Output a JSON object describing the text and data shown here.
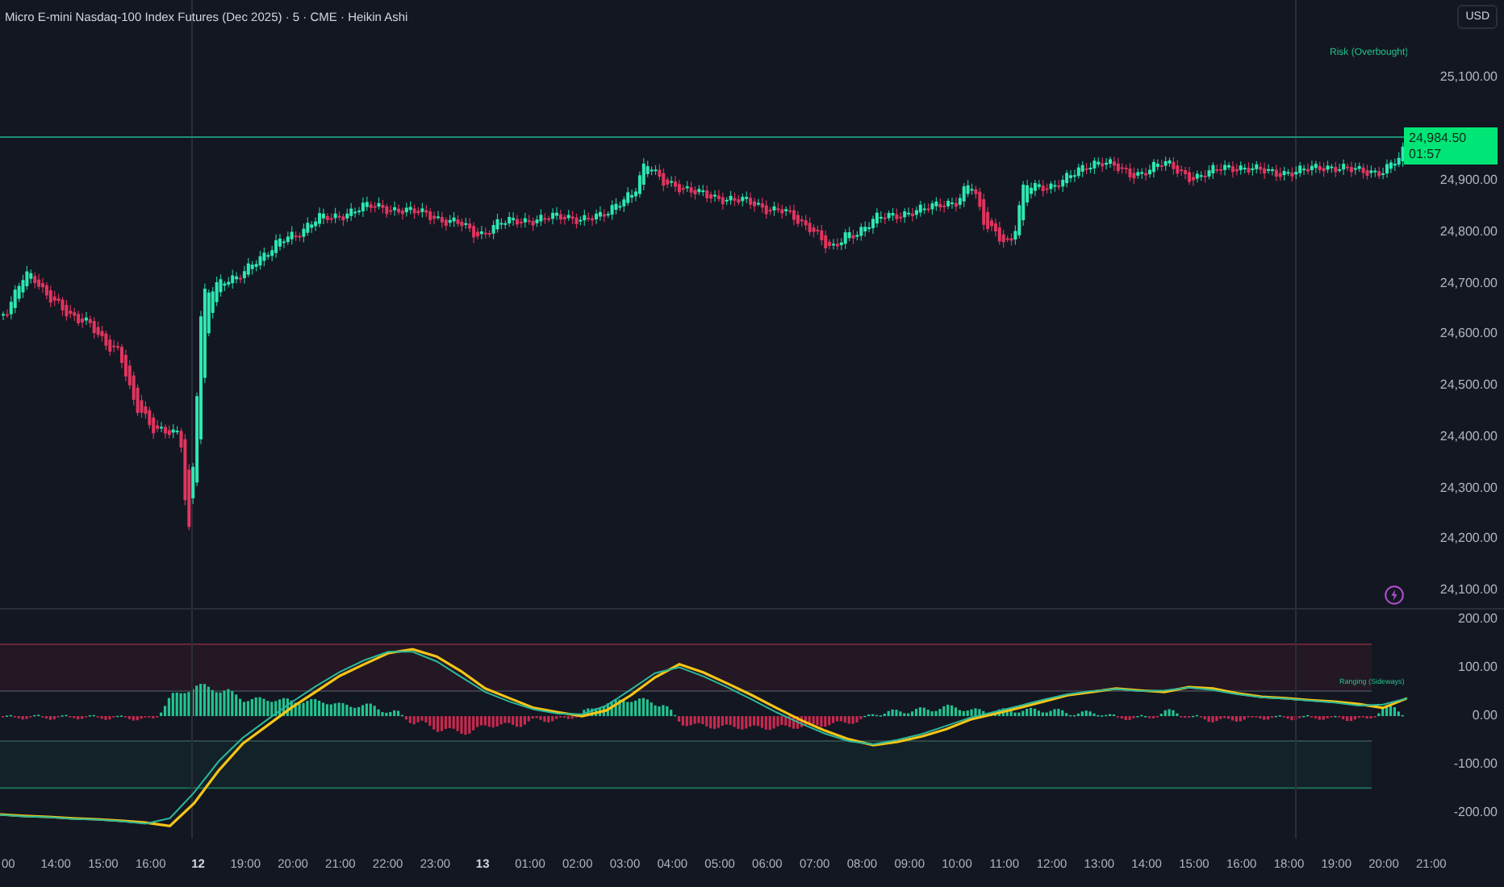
{
  "header": {
    "title": "Micro E-mini Nasdaq-100 Index Futures (Dec 2025) · 5 · CME · Heikin Ashi",
    "currency": "USD"
  },
  "main_pane": {
    "zone_label": "Risk (Overbought)"
  },
  "price_axis": {
    "upper": [
      "25,100.00"
    ],
    "lower": [
      "24,900.00",
      "24,800.00",
      "24,700.00",
      "24,600.00",
      "24,500.00",
      "24,400.00",
      "24,300.00",
      "24,200.00",
      "24,100.00"
    ]
  },
  "last_price": {
    "value": "24,984.50",
    "countdown": "01:57"
  },
  "indicator_pane": {
    "zone_label": "Ranging (Sideways)",
    "chart_data": {
      "type": "line",
      "ylim": [
        -253,
        220
      ],
      "yticks": [
        {
          "value": 200,
          "label": "200.00"
        },
        {
          "value": 100,
          "label": "100.00"
        },
        {
          "value": 0,
          "label": "0.00"
        },
        {
          "value": -100,
          "label": "-100.00"
        },
        {
          "value": -200,
          "label": "-200.00"
        }
      ],
      "series": [
        {
          "color": "#f5c518",
          "values": [
            -203,
            -206,
            -208,
            -211,
            -213,
            -216,
            -220,
            -227,
            -180,
            -113,
            -57,
            -20,
            17,
            50,
            83,
            107,
            130,
            138,
            123,
            93,
            57,
            37,
            17,
            8,
            0,
            12,
            43,
            80,
            107,
            90,
            67,
            43,
            17,
            -8,
            -30,
            -48,
            -60,
            -53,
            -42,
            -27,
            -7,
            5,
            17,
            30,
            43,
            50,
            57,
            53,
            50,
            60,
            57,
            47,
            40,
            37,
            33,
            30,
            25,
            17,
            37
          ]
        },
        {
          "color": "#2bb89a",
          "values": [
            -204,
            -207,
            -209,
            -212,
            -214,
            -217,
            -222,
            -211,
            -158,
            -94,
            -45,
            -8,
            28,
            61,
            91,
            115,
            133,
            133,
            113,
            81,
            50,
            30,
            14,
            5,
            4,
            22,
            55,
            89,
            101,
            82,
            59,
            34,
            8,
            -15,
            -36,
            -52,
            -58,
            -49,
            -37,
            -20,
            -3,
            9,
            21,
            34,
            45,
            52,
            56,
            52,
            53,
            59,
            54,
            45,
            39,
            36,
            32,
            28,
            22,
            24,
            37
          ]
        }
      ]
    }
  },
  "time_axis": [
    {
      "label": "00",
      "kind": "time"
    },
    {
      "label": "14:00",
      "kind": "time"
    },
    {
      "label": "15:00",
      "kind": "time"
    },
    {
      "label": "16:00",
      "kind": "time"
    },
    {
      "label": "12",
      "kind": "day"
    },
    {
      "label": "19:00",
      "kind": "time"
    },
    {
      "label": "20:00",
      "kind": "time"
    },
    {
      "label": "21:00",
      "kind": "time"
    },
    {
      "label": "22:00",
      "kind": "time"
    },
    {
      "label": "23:00",
      "kind": "time"
    },
    {
      "label": "13",
      "kind": "day"
    },
    {
      "label": "01:00",
      "kind": "time"
    },
    {
      "label": "02:00",
      "kind": "time"
    },
    {
      "label": "03:00",
      "kind": "time"
    },
    {
      "label": "04:00",
      "kind": "time"
    },
    {
      "label": "05:00",
      "kind": "time"
    },
    {
      "label": "06:00",
      "kind": "time"
    },
    {
      "label": "07:00",
      "kind": "time"
    },
    {
      "label": "08:00",
      "kind": "time"
    },
    {
      "label": "09:00",
      "kind": "time"
    },
    {
      "label": "10:00",
      "kind": "time"
    },
    {
      "label": "11:00",
      "kind": "time"
    },
    {
      "label": "12:00",
      "kind": "time"
    },
    {
      "label": "13:00",
      "kind": "time"
    },
    {
      "label": "14:00",
      "kind": "time"
    },
    {
      "label": "15:00",
      "kind": "time"
    },
    {
      "label": "16:00",
      "kind": "time"
    },
    {
      "label": "18:00",
      "kind": "time"
    },
    {
      "label": "19:00",
      "kind": "time"
    },
    {
      "label": "20:00",
      "kind": "time"
    },
    {
      "label": "21:00",
      "kind": "time"
    }
  ]
}
